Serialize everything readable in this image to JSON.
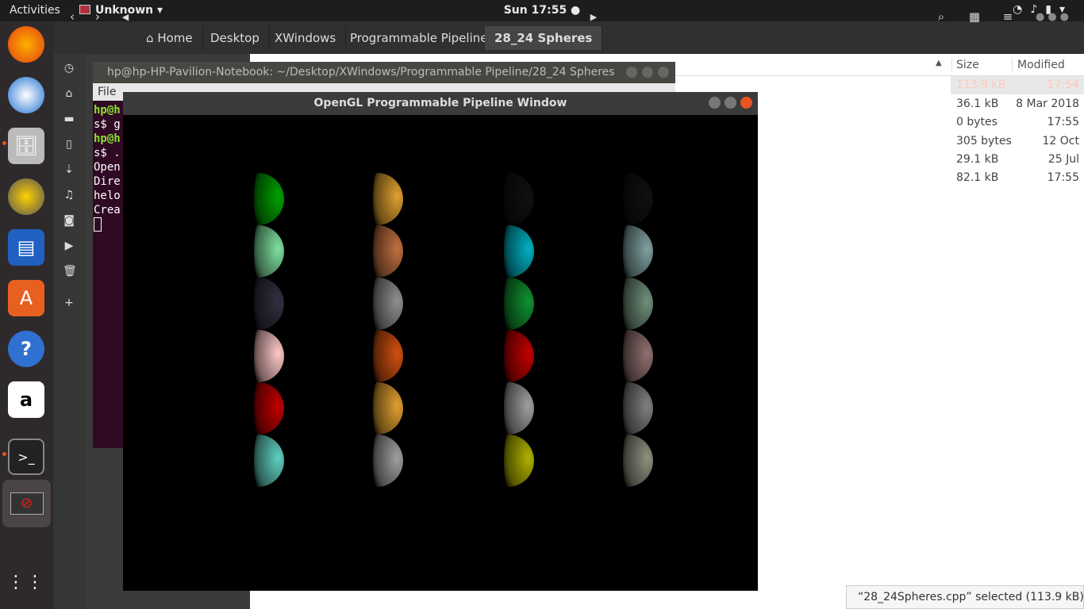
{
  "topbar": {
    "activities": "Activities",
    "app_name": "Unknown",
    "clock": "Sun 17:55 ●"
  },
  "nautilus": {
    "breadcrumbs": [
      "Home",
      "Desktop",
      "XWindows",
      "Programmable Pipeline",
      "28_24 Spheres"
    ],
    "columns": {
      "size": "Size",
      "modified": "Modified"
    },
    "files": [
      {
        "size": "113.9 kB",
        "modified": "17:54",
        "selected": true
      },
      {
        "size": "36.1 kB",
        "modified": "8 Mar 2018"
      },
      {
        "size": "0 bytes",
        "modified": "17:55"
      },
      {
        "size": "305 bytes",
        "modified": "12 Oct"
      },
      {
        "size": "29.1 kB",
        "modified": "25 Jul"
      },
      {
        "size": "82.1 kB",
        "modified": "17:55"
      }
    ],
    "status": "“28_24Spheres.cpp” selected  (113.9 kB)"
  },
  "terminal": {
    "title": "hp@hp-HP-Pavilion-Notebook: ~/Desktop/XWindows/Programmable Pipeline/28_24 Spheres",
    "menu_file": "File",
    "lines": [
      "hp@h",
      "s$ g",
      "hp@h",
      "s$ .",
      "Open",
      "Dire",
      "helo",
      "Crea"
    ]
  },
  "gl_window": {
    "title": "OpenGL Programmable Pipeline Window"
  },
  "spheres": {
    "columns": [
      [
        "#00a000",
        "#7fe0a0",
        "#303040",
        "#ffc8c8",
        "#c00000",
        "#60d0c0"
      ],
      [
        "#e0a030",
        "#c07040",
        "#909090",
        "#d05010",
        "#e0a030",
        "#a0a0a0"
      ],
      [
        "#101010",
        "#00b0c0",
        "#109030",
        "#c00000",
        "#a0a0a0",
        "#b0b000"
      ],
      [
        "#101010",
        "#80a0a0",
        "#70907a",
        "#907070",
        "#808080",
        "#909080"
      ]
    ]
  }
}
